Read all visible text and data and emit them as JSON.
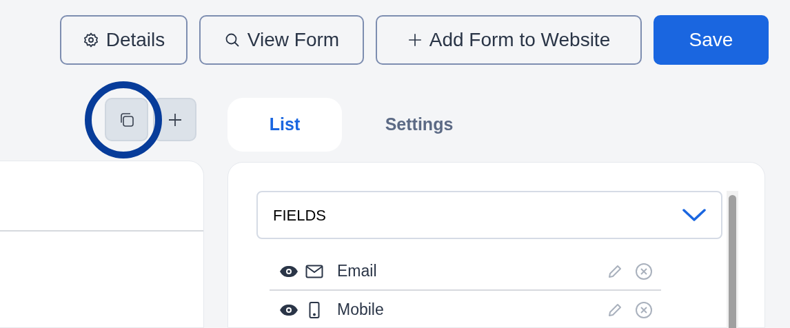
{
  "toolbar": {
    "buttons": [
      {
        "label": "Details",
        "kind": "outline"
      },
      {
        "label": "View Form",
        "kind": "outline"
      },
      {
        "label": "Add Form to Website",
        "kind": "outline"
      },
      {
        "label": "Save",
        "kind": "primary"
      }
    ]
  },
  "tabs": [
    {
      "label": "List",
      "selected": true
    },
    {
      "label": "Settings",
      "selected": false
    }
  ],
  "fields_panel": {
    "dropdown": {
      "label": "FIELDS"
    },
    "fields": [
      {
        "label": "Email",
        "kind": "email",
        "visible": true
      },
      {
        "label": "Mobile",
        "kind": "phone",
        "visible": true
      }
    ]
  }
}
